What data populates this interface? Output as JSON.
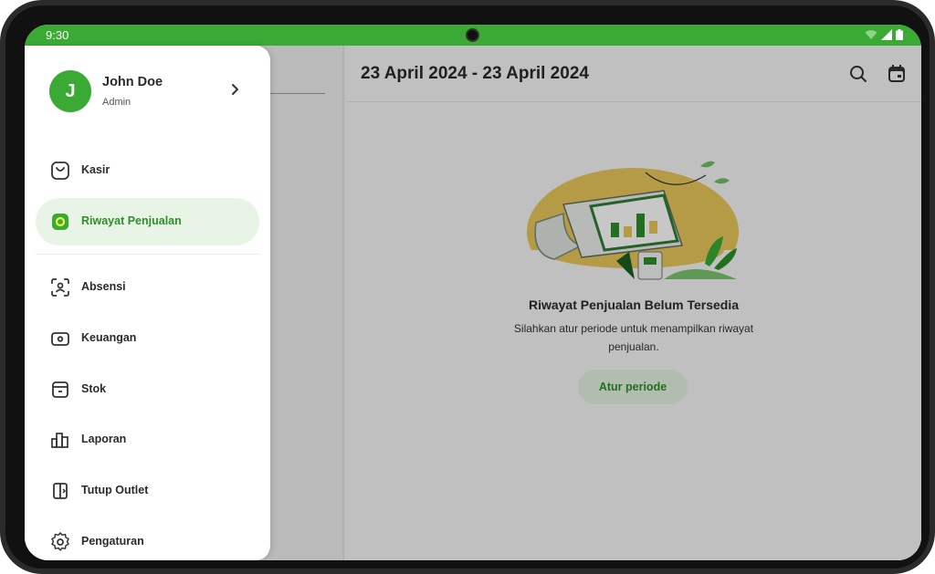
{
  "status_bar": {
    "time": "9:30"
  },
  "profile": {
    "initial": "J",
    "name": "John Doe",
    "role": "Admin"
  },
  "menu": {
    "items": [
      {
        "label": "Kasir",
        "icon": "bag-icon"
      },
      {
        "label": "Riwayat Penjualan",
        "icon": "history-icon",
        "active": true
      },
      {
        "label": "Absensi",
        "icon": "face-scan-icon"
      },
      {
        "label": "Keuangan",
        "icon": "money-icon"
      },
      {
        "label": "Stok",
        "icon": "box-icon"
      },
      {
        "label": "Laporan",
        "icon": "bar-chart-icon"
      },
      {
        "label": "Tutup Outlet",
        "icon": "door-exit-icon"
      },
      {
        "label": "Pengaturan",
        "icon": "gear-icon"
      }
    ]
  },
  "header": {
    "period": "23 April 2024 - 23 April 2024"
  },
  "empty_state": {
    "title": "Riwayat Penjualan Belum Tersedia",
    "description": "Silahkan atur periode untuk menampilkan riwayat penjualan.",
    "button_label": "Atur periode"
  },
  "colors": {
    "primary": "#3aaa35",
    "primary_light": "#e8f5e6",
    "accent_yellow": "#e9c75a"
  }
}
